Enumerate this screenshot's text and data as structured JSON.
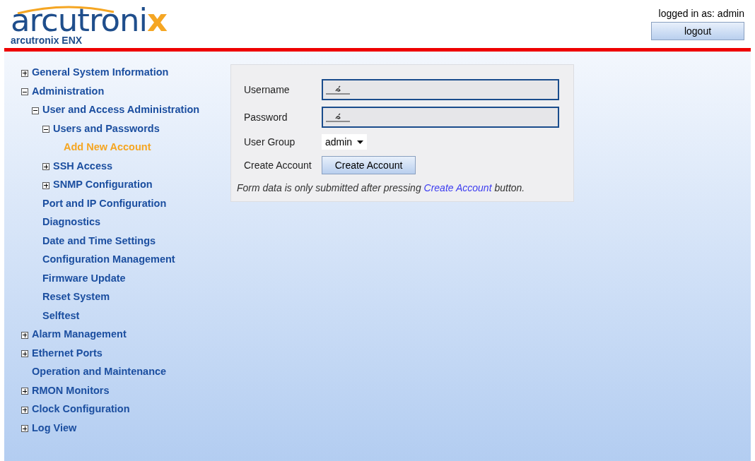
{
  "header": {
    "logo": "arcutronix",
    "product": "arcutronix ENX",
    "login_status": "logged in as: admin",
    "logout_button": "logout"
  },
  "nav": [
    {
      "label": "General System Information",
      "kind": "branch",
      "expanded": false,
      "selected": false
    },
    {
      "label": "Administration",
      "kind": "branch",
      "expanded": true,
      "selected": false,
      "children": [
        {
          "label": "User and Access Administration",
          "kind": "branch",
          "expanded": true,
          "selected": false,
          "children": [
            {
              "label": "Users and Passwords",
              "kind": "branch",
              "expanded": true,
              "selected": false,
              "children": [
                {
                  "label": "Add New Account",
                  "selected": true
                }
              ]
            },
            {
              "label": "SSH Access",
              "kind": "branch",
              "expanded": false,
              "selected": false
            },
            {
              "label": "SNMP Configuration",
              "kind": "branch",
              "expanded": false,
              "selected": false
            }
          ]
        },
        {
          "label": "Port and IP Configuration",
          "kind": "leaf",
          "selected": false
        },
        {
          "label": "Diagnostics",
          "kind": "leaf",
          "selected": false
        },
        {
          "label": "Date and Time Settings",
          "kind": "leaf",
          "selected": false
        },
        {
          "label": "Configuration Management",
          "kind": "leaf",
          "selected": false
        },
        {
          "label": "Firmware Update",
          "kind": "leaf",
          "selected": false
        },
        {
          "label": "Reset System",
          "kind": "leaf",
          "selected": false
        },
        {
          "label": "Selftest",
          "kind": "leaf",
          "selected": false
        }
      ]
    },
    {
      "label": "Alarm Management",
      "kind": "branch",
      "expanded": false,
      "selected": false
    },
    {
      "label": "Ethernet Ports",
      "kind": "branch",
      "expanded": false,
      "selected": false
    },
    {
      "label": "Operation and Maintenance",
      "kind": "leaf",
      "selected": false
    },
    {
      "label": "RMON Monitors",
      "kind": "branch",
      "expanded": false,
      "selected": false
    },
    {
      "label": "Clock Configuration",
      "kind": "branch",
      "expanded": false,
      "selected": false
    },
    {
      "label": "Log View",
      "kind": "branch",
      "expanded": false,
      "selected": false
    }
  ],
  "form": {
    "fields": [
      {
        "label": "Username",
        "kind": "text"
      },
      {
        "label": "Password",
        "kind": "password"
      },
      {
        "label": "User Group",
        "kind": "select",
        "value": "admin"
      },
      {
        "label": "Create Account",
        "kind": "button",
        "button": "Create Account"
      }
    ],
    "note": {
      "before": "Form data is only submitted after pressing",
      "link": "Create Account",
      "after": "button."
    }
  }
}
